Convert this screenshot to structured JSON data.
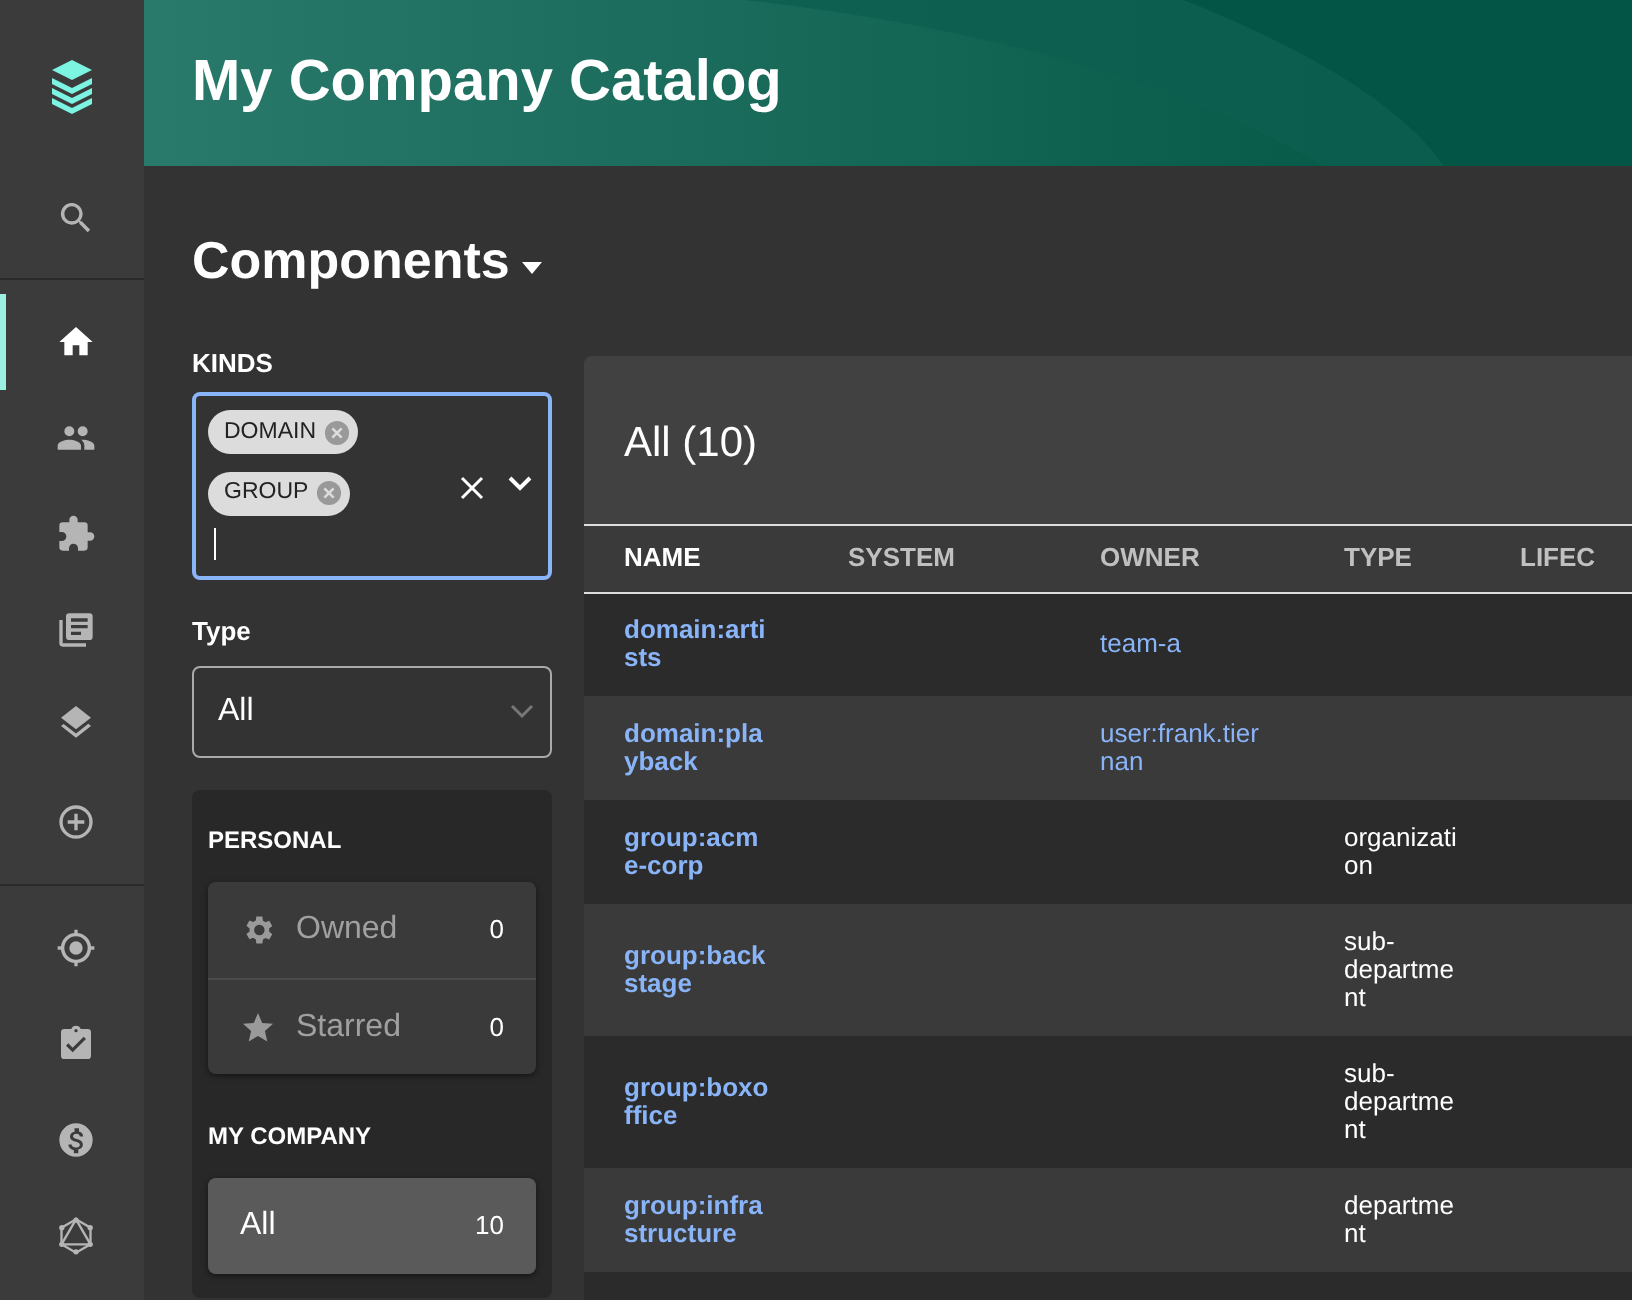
{
  "sidebar": {
    "items": [
      {
        "selected": false
      },
      {
        "selected": true
      },
      {
        "selected": false
      },
      {
        "selected": false
      },
      {
        "selected": false
      },
      {
        "selected": false
      },
      {
        "selected": false
      },
      {
        "selected": false
      },
      {
        "selected": false
      },
      {
        "selected": false
      },
      {
        "selected": false
      }
    ]
  },
  "header": {
    "title": "My Company Catalog"
  },
  "page": {
    "title": "Components"
  },
  "filters": {
    "kinds": {
      "label": "KINDS",
      "chips": [
        "DOMAIN",
        "GROUP"
      ],
      "focused": true
    },
    "type": {
      "label": "Type",
      "value": "All"
    },
    "sections": [
      {
        "title": "PERSONAL",
        "items": [
          {
            "label": "Owned",
            "count": "0",
            "selected": false
          },
          {
            "label": "Starred",
            "count": "0",
            "selected": false
          }
        ]
      },
      {
        "title": "MY COMPANY",
        "items": [
          {
            "label": "All",
            "count": "10",
            "selected": true
          }
        ]
      }
    ]
  },
  "table": {
    "title": "All (10)",
    "columns": [
      {
        "label": "NAME",
        "sorted": true
      },
      {
        "label": "SYSTEM",
        "sorted": false
      },
      {
        "label": "OWNER",
        "sorted": false
      },
      {
        "label": "TYPE",
        "sorted": false
      },
      {
        "label": "LIFEC",
        "sorted": false
      }
    ],
    "rows": [
      {
        "name": "domain:artists",
        "owner": "team-a",
        "type": ""
      },
      {
        "name": "domain:playback",
        "owner": "user:frank.tiernan",
        "type": ""
      },
      {
        "name": "group:acme-corp",
        "owner": "",
        "type": "organization"
      },
      {
        "name": "group:backstage",
        "owner": "",
        "type": "sub-department"
      },
      {
        "name": "group:boxoffice",
        "owner": "",
        "type": "sub-department"
      },
      {
        "name": "group:infrastructure",
        "owner": "",
        "type": "department"
      }
    ]
  }
}
